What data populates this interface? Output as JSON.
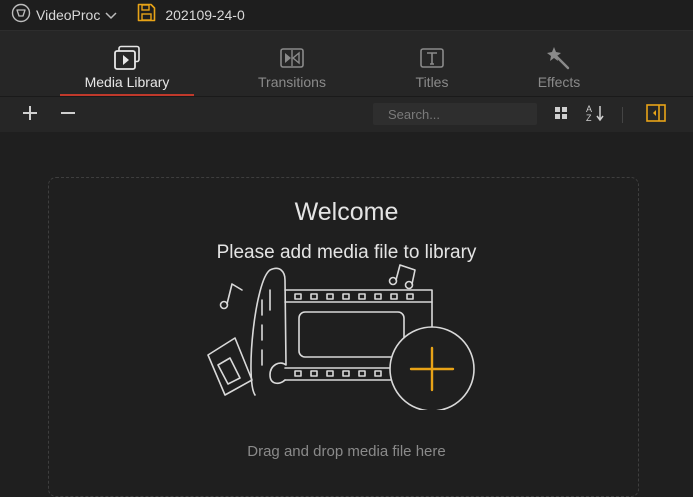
{
  "app": {
    "name": "VideoProc",
    "project_name": "202109-24-0"
  },
  "tabs": [
    {
      "label": "Media Library",
      "icon": "media-library-icon",
      "active": true
    },
    {
      "label": "Transitions",
      "icon": "transitions-icon",
      "active": false
    },
    {
      "label": "Titles",
      "icon": "titles-icon",
      "active": false
    },
    {
      "label": "Effects",
      "icon": "effects-icon",
      "active": false
    }
  ],
  "toolbar": {
    "search_placeholder": "Search...",
    "add_icon": "plus-icon",
    "remove_icon": "minus-icon",
    "grid_icon": "grid-view-icon",
    "sort_icon": "sort-az-icon",
    "panel_icon": "collapse-panel-icon"
  },
  "main": {
    "welcome": "Welcome",
    "subtitle": "Please add media file to library",
    "hint": "Drag and drop media file here"
  },
  "colors": {
    "accent": "#e8a317",
    "tab_underline": "#c0392b",
    "background": "#1f1f1f"
  }
}
